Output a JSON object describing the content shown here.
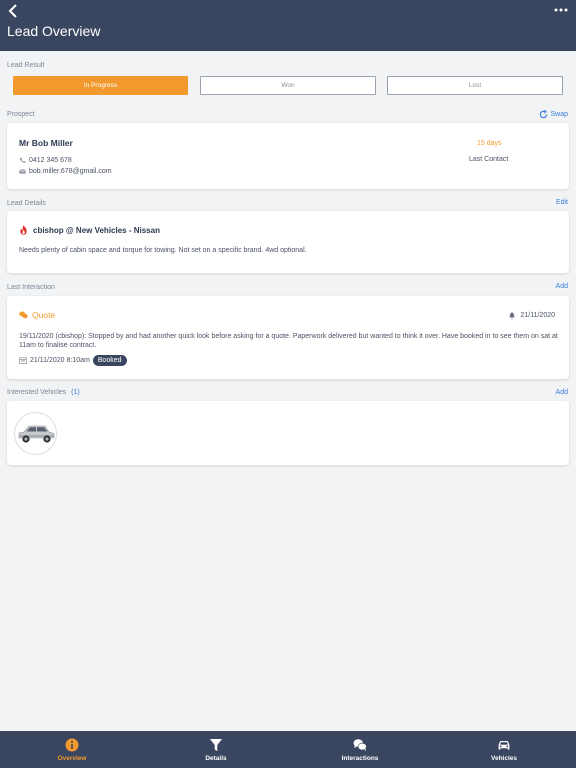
{
  "header": {
    "title": "Lead Overview"
  },
  "lead_result": {
    "label": "Lead Result",
    "options": [
      {
        "label": "In Progress",
        "selected": true
      },
      {
        "label": "Won",
        "selected": false
      },
      {
        "label": "Lost",
        "selected": false
      }
    ]
  },
  "prospect": {
    "label": "Prospect",
    "action": "Swap",
    "name": "Mr Bob Miller",
    "phone": "0412 345 678",
    "email": "bob.miller.678@gmail.com",
    "days": "15 days",
    "days_caption": "Last Contact"
  },
  "lead_details": {
    "label": "Lead Details",
    "action": "Edit",
    "title": "cbishop @ New Vehicles - Nissan",
    "description": "Needs plenty of cabin space and torque for towing. Not set on a specific brand. 4wd optional."
  },
  "last_interaction": {
    "label": "Last Interaction",
    "action": "Add",
    "type": "Quote",
    "date": "21/11/2020",
    "text": "19/11/2020 (cbishop): Stopped by and had another quick look before asking for a quote. Paperwork delivered but wanted to think it over. Have booked in to see them on sat at 11am to finalise contract.",
    "booking_time": "21/11/2020 8:10am",
    "badge": "Booked"
  },
  "interested_vehicles": {
    "label": "Interested Vehicles",
    "count": "(1)",
    "action": "Add"
  },
  "tabbar": {
    "tabs": [
      {
        "label": "Overview",
        "icon": "info-icon",
        "active": true
      },
      {
        "label": "Details",
        "icon": "funnel-icon",
        "active": false
      },
      {
        "label": "Interactions",
        "icon": "chat-bubbles-icon",
        "active": false
      },
      {
        "label": "Vehicles",
        "icon": "car-icon",
        "active": false
      }
    ]
  },
  "colors": {
    "accent": "#f29a2e",
    "header": "#3a4660",
    "link": "#3b7ddd",
    "background": "#f2f3f5"
  }
}
